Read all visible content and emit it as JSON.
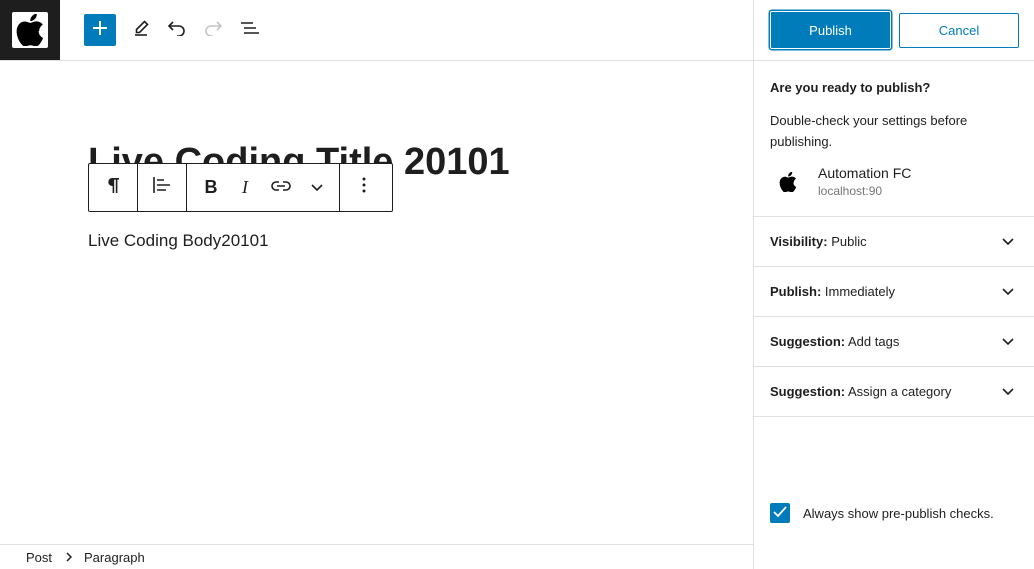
{
  "header": {
    "site_icon": "apple-logo-icon",
    "add_icon": "plus-icon",
    "tools_icon": "pencil-icon",
    "undo_icon": "undo-icon",
    "redo_icon": "redo-icon",
    "outline_icon": "list-view-icon"
  },
  "editor": {
    "title": "Live Coding Title 20101",
    "body": "Live Coding Body20101",
    "block_toolbar": {
      "paragraph_icon": "paragraph-icon",
      "align_icon": "align-left-icon",
      "bold_label": "B",
      "italic_label": "I",
      "link_icon": "link-icon",
      "more_icon": "chevron-down-icon",
      "options_icon": "more-vertical-icon"
    }
  },
  "footer": {
    "breadcrumbs": [
      "Post",
      "Paragraph"
    ]
  },
  "sidebar": {
    "publish_label": "Publish",
    "cancel_label": "Cancel",
    "heading": "Are you ready to publish?",
    "description": "Double-check your settings before publishing.",
    "site_name": "Automation FC",
    "site_url": "localhost:90",
    "panels": [
      {
        "label": "Visibility:",
        "value": "Public"
      },
      {
        "label": "Publish:",
        "value": "Immediately"
      },
      {
        "label": "Suggestion:",
        "value": "Add tags"
      },
      {
        "label": "Suggestion:",
        "value": "Assign a category"
      }
    ],
    "always_show_label": "Always show pre-publish checks.",
    "always_show_checked": true
  },
  "colors": {
    "accent": "#007cba",
    "dark": "#1e1e1e",
    "border": "#e0e0e0"
  }
}
